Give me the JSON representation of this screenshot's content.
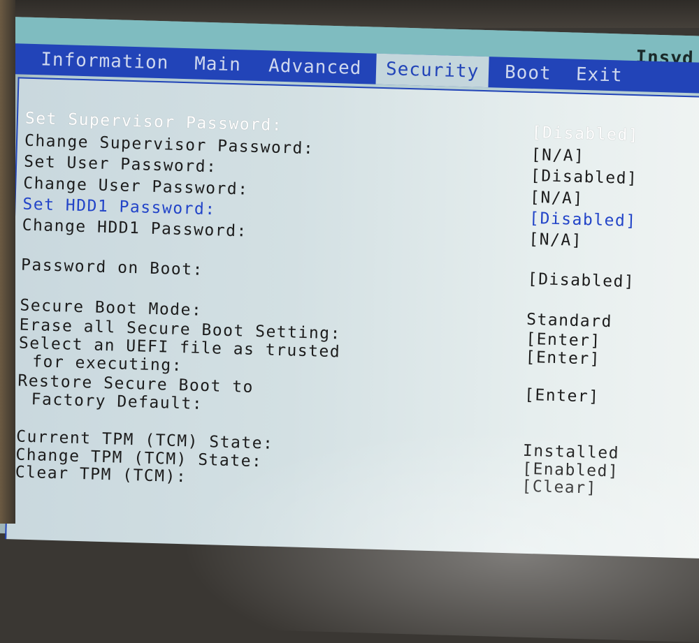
{
  "header": {
    "vendor": "Insyd"
  },
  "tabs": [
    {
      "label": "Information"
    },
    {
      "label": "Main"
    },
    {
      "label": "Advanced"
    },
    {
      "label": "Security"
    },
    {
      "label": "Boot"
    },
    {
      "label": "Exit"
    }
  ],
  "active_tab": "Security",
  "settings": [
    {
      "label": "Set Supervisor Password:",
      "value": "[Disabled]"
    },
    {
      "label": "Change Supervisor Password:",
      "value": "[N/A]"
    },
    {
      "label": "Set User Password:",
      "value": "[Disabled]"
    },
    {
      "label": "Change User Password:",
      "value": "[N/A]"
    },
    {
      "label": "Set HDD1 Password:",
      "value": "[Disabled]"
    },
    {
      "label": "Change HDD1 Password:",
      "value": "[N/A]"
    },
    {
      "label": "Password on Boot:",
      "value": "[Disabled]"
    },
    {
      "label": "Secure Boot Mode:",
      "value": "Standard"
    },
    {
      "label": "Erase all Secure Boot Setting:",
      "value": "[Enter]"
    },
    {
      "label": "Select an UEFI file as trusted",
      "label_cont": "for executing:",
      "value": "[Enter]"
    },
    {
      "label": "Restore Secure Boot to",
      "label_cont": "Factory Default:",
      "value": "[Enter]"
    },
    {
      "label": "Current TPM (TCM) State:",
      "value": "Installed"
    },
    {
      "label": "Change TPM (TCM) State:",
      "value": "[Enabled]"
    },
    {
      "label": "Clear TPM (TCM):",
      "value": "[Clear]"
    }
  ],
  "colors": {
    "tabbar": "#2244b8",
    "selected_text": "#2244c8",
    "screen_bg": "#c9d8de"
  }
}
